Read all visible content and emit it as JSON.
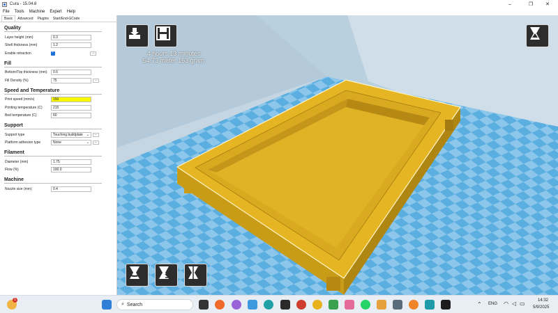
{
  "window": {
    "title": "Cura - 15.04.6",
    "min": "–",
    "max": "❐",
    "close": "✕"
  },
  "menu": [
    "File",
    "Tools",
    "Machine",
    "Expert",
    "Help"
  ],
  "tabs": [
    "Basic",
    "Advanced",
    "Plugins",
    "Start/End-GCode"
  ],
  "sections": {
    "quality": {
      "title": "Quality",
      "layer_height": {
        "label": "Layer height (mm)",
        "value": "0.3"
      },
      "shell_thickness": {
        "label": "Shell thickness (mm)",
        "value": "1.2"
      },
      "enable_retraction": {
        "label": "Enable retraction",
        "checked": true,
        "more": "..."
      }
    },
    "fill": {
      "title": "Fill",
      "bottom_top": {
        "label": "Bottom/Top thickness (mm)",
        "value": "0.6"
      },
      "fill_density": {
        "label": "Fill Density (%)",
        "value": "75",
        "more": "..."
      }
    },
    "speed": {
      "title": "Speed and Temperature",
      "print_speed": {
        "label": "Print speed (mm/s)",
        "value": "150"
      },
      "print_temp": {
        "label": "Printing temperature (C)",
        "value": "215"
      },
      "bed_temp": {
        "label": "Bed temperature (C)",
        "value": "60"
      }
    },
    "support": {
      "title": "Support",
      "support_type": {
        "label": "Support type",
        "value": "Touching buildplate",
        "more": "..."
      },
      "adhesion": {
        "label": "Platform adhesion type",
        "value": "None",
        "more": "..."
      }
    },
    "filament": {
      "title": "Filament",
      "diameter": {
        "label": "Diameter (mm)",
        "value": "1.75"
      },
      "flow": {
        "label": "Flow (%)",
        "value": "100.0"
      }
    },
    "machine": {
      "title": "Machine",
      "nozzle": {
        "label": "Nozzle size (mm)",
        "value": "0.4"
      }
    }
  },
  "print_info": {
    "time": "4 hours 13 minutes",
    "material": "54.73 meter 163 gram"
  },
  "colors": {
    "model": "#e5b523",
    "bed_blue": "#5aaee0",
    "highlight": "#f7f700"
  },
  "taskbar": {
    "search_placeholder": "Search",
    "notification_count": "1",
    "language": "ENG",
    "time": "14:32",
    "date": "5/9/2025"
  }
}
